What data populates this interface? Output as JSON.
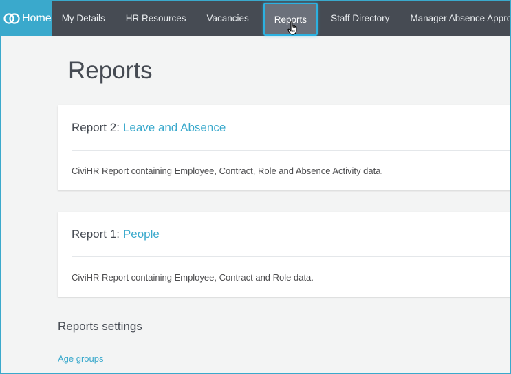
{
  "nav": {
    "home_label": "Home",
    "items": [
      {
        "label": "My Details"
      },
      {
        "label": "HR Resources"
      },
      {
        "label": "Vacancies"
      },
      {
        "label": "Reports"
      },
      {
        "label": "Staff Directory"
      },
      {
        "label": "Manager Absence Approval"
      }
    ],
    "active_index": 3
  },
  "page": {
    "title": "Reports"
  },
  "reports": [
    {
      "prefix": "Report 2:",
      "name": "Leave and Absence",
      "description": "CiviHR Report containing Employee, Contract, Role and Absence Activity data."
    },
    {
      "prefix": "Report 1:",
      "name": "People",
      "description": "CiviHR Report containing Employee, Contract and Role data."
    }
  ],
  "settings": {
    "title": "Reports settings",
    "links": [
      {
        "label": "Age groups"
      }
    ]
  },
  "colors": {
    "accent": "#3aa9cc",
    "navbar": "#464b53",
    "active_tab": "#6b707a",
    "background": "#f3f4f4"
  }
}
